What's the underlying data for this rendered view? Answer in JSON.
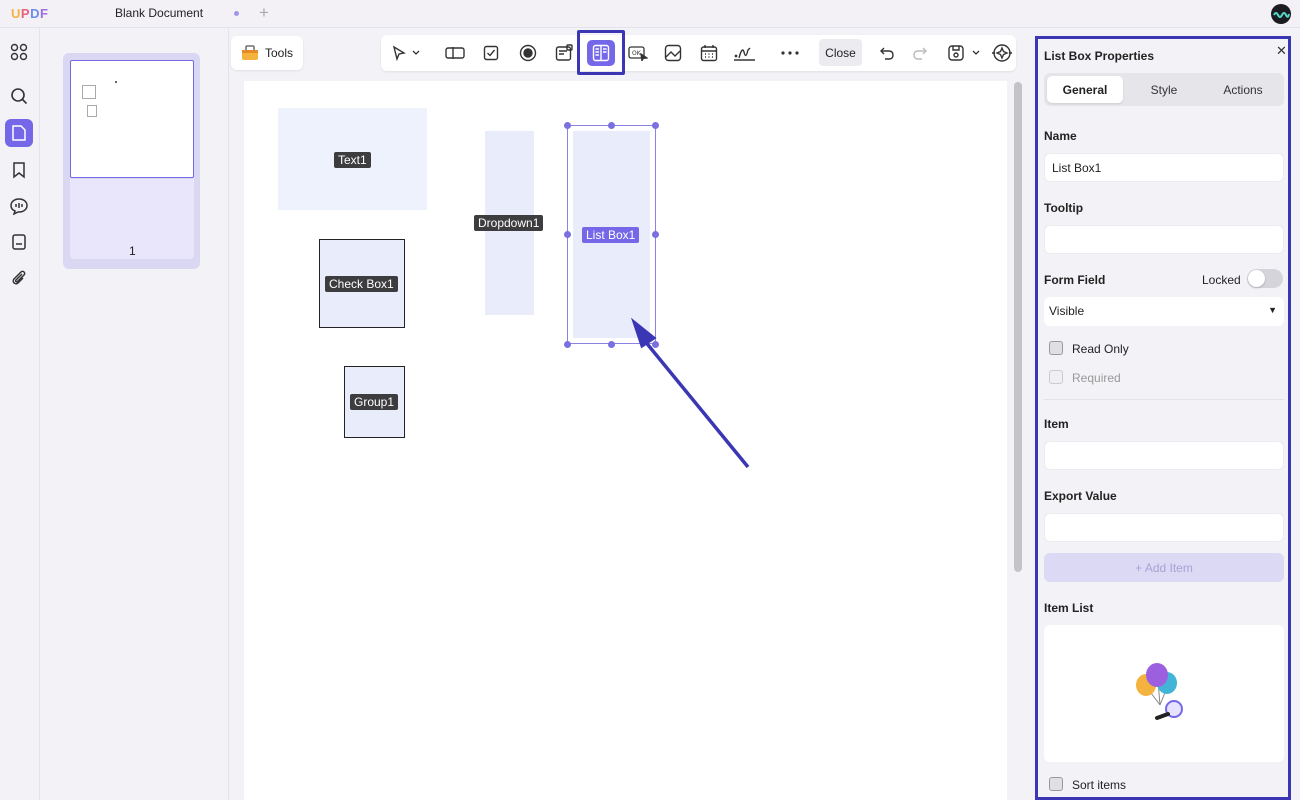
{
  "app": {
    "logo": "UPDF",
    "document_tab": "Blank Document",
    "page_number": "1"
  },
  "toolbar": {
    "tools_label": "Tools",
    "close_label": "Close"
  },
  "canvas": {
    "fields": {
      "text": "Text1",
      "dropdown": "Dropdown1",
      "listbox": "List Box1",
      "checkbox": "Check Box1",
      "group": "Group1"
    }
  },
  "props": {
    "title": "List Box Properties",
    "tabs": [
      "General",
      "Style",
      "Actions"
    ],
    "name_label": "Name",
    "name_value": "List Box1",
    "tooltip_label": "Tooltip",
    "tooltip_value": "",
    "form_field_label": "Form Field",
    "locked_label": "Locked",
    "locked_on": false,
    "visibility_value": "Visible",
    "read_only_label": "Read Only",
    "required_label": "Required",
    "item_label": "Item",
    "item_value": "",
    "export_value_label": "Export Value",
    "export_value": "",
    "add_item_label": "+ Add Item",
    "item_list_label": "Item List",
    "sort_items_label": "Sort items"
  },
  "colors": {
    "accent": "#7468e8",
    "highlight": "#3b36b3",
    "field_fill": "#e8ecfb"
  }
}
